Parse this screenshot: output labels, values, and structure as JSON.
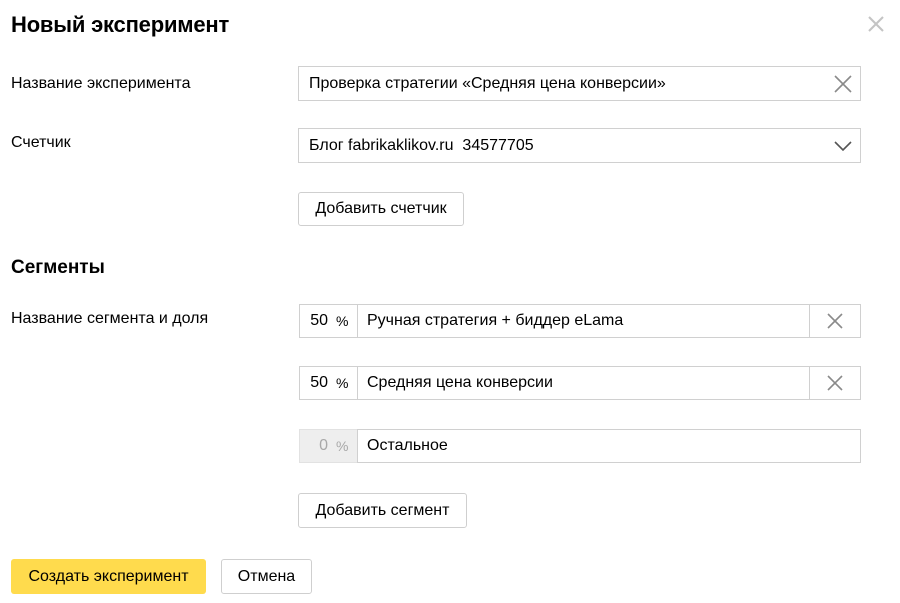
{
  "dialog": {
    "title": "Новый эксперимент",
    "close_icon": "close-icon"
  },
  "form": {
    "experiment_name_label": "Название эксперимента",
    "experiment_name_value": "Проверка стратегии «Средняя цена конверсии»",
    "counter_label": "Счетчик",
    "counter_value": "Блог fabrikaklikov.ru  34577705",
    "add_counter_label": "Добавить счетчик"
  },
  "segments": {
    "section_title": "Сегменты",
    "row_label": "Название сегмента и доля",
    "percent_symbol": "%",
    "items": [
      {
        "share": "50",
        "name": "Ручная стратегия + биддер eLama",
        "removable": true
      },
      {
        "share": "50",
        "name": "Средняя цена конверсии",
        "removable": true
      },
      {
        "share": "0",
        "name": "Остальное",
        "removable": false
      }
    ],
    "add_segment_label": "Добавить сегмент"
  },
  "footer": {
    "create_label": "Создать эксперимент",
    "cancel_label": "Отмена"
  },
  "colors": {
    "primary_button": "#ffdb4d",
    "border": "#d0d0d0",
    "disabled_bg": "#eeeeee"
  }
}
